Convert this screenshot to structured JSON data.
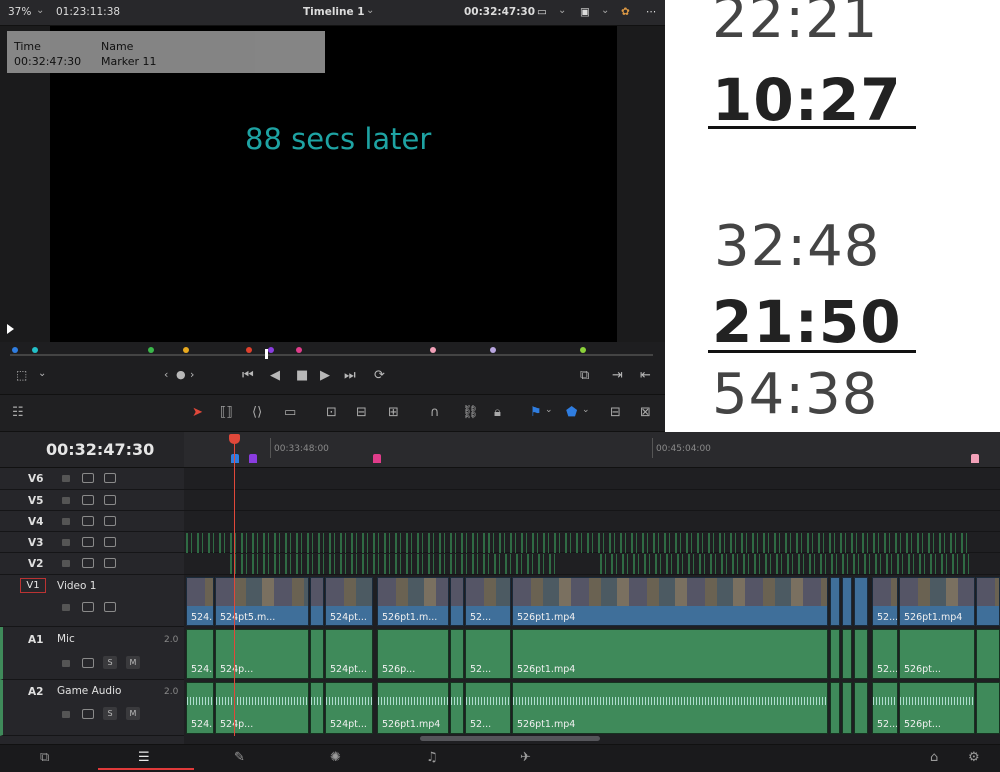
{
  "viewer": {
    "zoom": "37%",
    "source_timecode": "01:23:11:38",
    "timeline_name": "Timeline 1",
    "record_timecode": "00:32:47:30",
    "marker_overlay": {
      "time_label": "Time",
      "time_value": "00:32:47:30",
      "name_label": "Name",
      "name_value": "Marker 11"
    },
    "title_text": "88 secs later"
  },
  "reference_image": {
    "lines": [
      "22:21",
      "10:27",
      "32:48",
      "21:50",
      "54:38"
    ]
  },
  "timeline": {
    "current_timecode": "00:32:47:30",
    "ruler_labels": [
      "00:33:48:00",
      "00:45:04:00"
    ],
    "video_tracks": [
      {
        "id": "V6",
        "name": ""
      },
      {
        "id": "V5",
        "name": ""
      },
      {
        "id": "V4",
        "name": ""
      },
      {
        "id": "V3",
        "name": ""
      },
      {
        "id": "V2",
        "name": ""
      },
      {
        "id": "V1",
        "name": "Video 1"
      }
    ],
    "audio_tracks": [
      {
        "id": "A1",
        "name": "Mic",
        "channels": "2.0",
        "solo": "S",
        "mute": "M"
      },
      {
        "id": "A2",
        "name": "Game Audio",
        "channels": "2.0",
        "solo": "S",
        "mute": "M"
      }
    ],
    "v1_clips": [
      "524...",
      "524pt5.m...",
      "524pt...",
      "526pt1.m...",
      "52...",
      "526pt1.mp4",
      "52...",
      "526pt1.mp4"
    ],
    "a1_clips": [
      "524...",
      "524p...",
      "524pt...",
      "526p...",
      "52...",
      "526pt1.mp4",
      "52...",
      "526pt..."
    ],
    "a2_clips": [
      "524...",
      "524p...",
      "524pt...",
      "526pt1.mp4",
      "52...",
      "526pt1.mp4",
      "52...",
      "526pt..."
    ]
  },
  "colors": {
    "playhead": "#e0483a",
    "video_clip": "#3f6f9a",
    "audio_clip": "#3f8a5a",
    "title_text": "#1ea3a3"
  }
}
